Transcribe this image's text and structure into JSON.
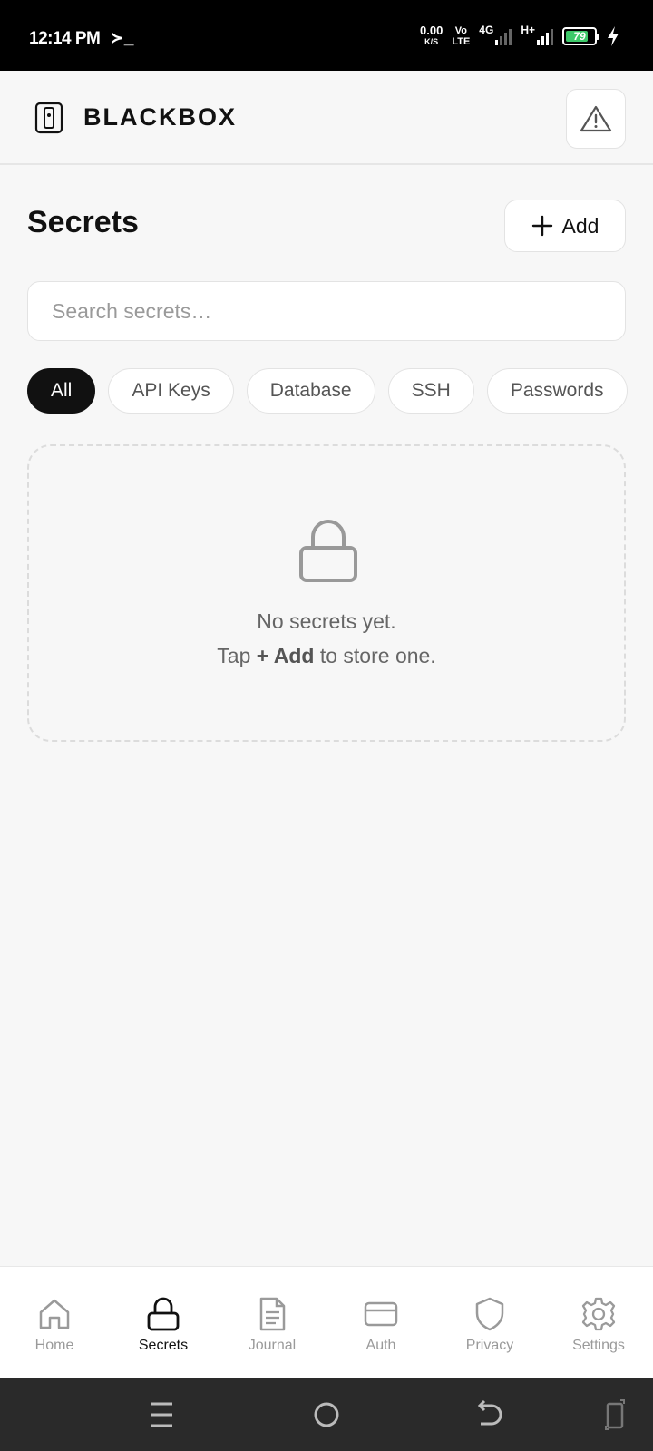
{
  "status_bar": {
    "time": "12:14 PM",
    "terminal_glyph": "≻_",
    "speed_value": "0.00",
    "speed_unit": "K/S",
    "volte_top": "Vo",
    "volte_bottom": "LTE",
    "net1": "4G",
    "net2": "H+",
    "battery": "79",
    "battery_level_pct": 79,
    "battery_color": "#3ec96a"
  },
  "header": {
    "brand": "BLACKBOX",
    "logo_icon": "device-icon",
    "alert_icon": "warning-triangle-icon"
  },
  "page": {
    "title": "Secrets",
    "add_label": "Add",
    "add_icon": "plus-icon"
  },
  "search": {
    "placeholder": "Search secrets…",
    "value": ""
  },
  "filters": [
    {
      "label": "All",
      "active": true
    },
    {
      "label": "API Keys",
      "active": false
    },
    {
      "label": "Database",
      "active": false
    },
    {
      "label": "SSH",
      "active": false
    },
    {
      "label": "Passwords",
      "active": false
    }
  ],
  "empty_state": {
    "icon": "lock-icon",
    "line1": "No secrets yet.",
    "line2_prefix": "Tap ",
    "line2_emphasis": "+ Add",
    "line2_suffix": " to store one."
  },
  "bottom_nav": [
    {
      "label": "Home",
      "icon": "home-icon",
      "active": false
    },
    {
      "label": "Secrets",
      "icon": "lock-icon",
      "active": true
    },
    {
      "label": "Journal",
      "icon": "document-icon",
      "active": false
    },
    {
      "label": "Auth",
      "icon": "card-icon",
      "active": false
    },
    {
      "label": "Privacy",
      "icon": "shield-icon",
      "active": false
    },
    {
      "label": "Settings",
      "icon": "gear-icon",
      "active": false
    }
  ],
  "system_nav": [
    "menu-icon",
    "home-circle-icon",
    "back-icon",
    "rotate-icon"
  ],
  "colors": {
    "background": "#f7f7f7",
    "active_chip": "#111111",
    "inactive_text": "#9a9a9a"
  }
}
